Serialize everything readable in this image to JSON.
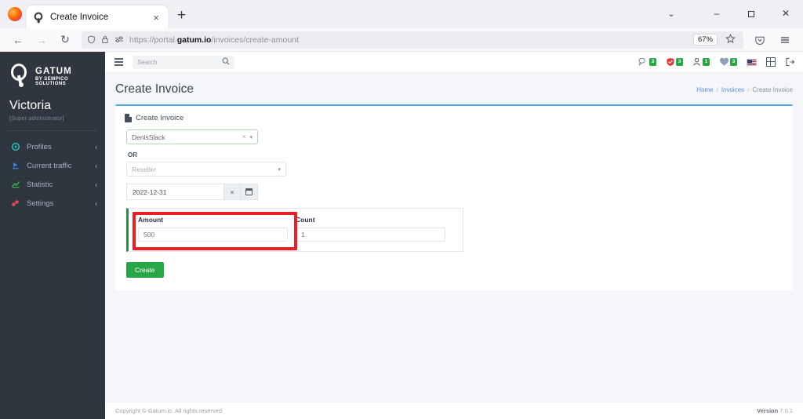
{
  "browser": {
    "tab": {
      "title": "Create Invoice",
      "favicon": "gatum-logo-icon",
      "close_label": "×"
    },
    "newtab_label": "+",
    "window_controls": {
      "chevron": "⌄",
      "minimize": "–",
      "maximize": "❐",
      "close": "✕"
    },
    "nav": {
      "back": "←",
      "forward": "→",
      "reload": "↻"
    },
    "url": {
      "prefix": "https://portal.",
      "domain": "gatum.io",
      "path": "/invoices/create-amount"
    },
    "zoom_level": "67%",
    "icons": {
      "shield": "shield-icon",
      "lock": "lock-icon",
      "tracking": "tracking-protection-icon",
      "bookmark": "star-icon",
      "pocket": "pocket-icon",
      "menu": "app-menu-icon"
    }
  },
  "sidebar": {
    "brand": {
      "name": "GATUM",
      "subtitle": "BY SEMPICO SOLUTIONS"
    },
    "user": {
      "name": "Victoria",
      "role": "[Super administrator]"
    },
    "items": [
      {
        "label": "Profiles",
        "icon": "profiles-icon",
        "color": "#2bb5a8",
        "chevron": "‹"
      },
      {
        "label": "Current traffic",
        "icon": "traffic-icon",
        "color": "#3b7ddd",
        "chevron": "‹"
      },
      {
        "label": "Statistic",
        "icon": "statistic-icon",
        "color": "#3fae4a",
        "chevron": "‹"
      },
      {
        "label": "Settings",
        "icon": "settings-icon",
        "color": "#e04b4b",
        "chevron": "‹"
      }
    ]
  },
  "topbar": {
    "menu_toggle": "hamburger-icon",
    "search": {
      "placeholder": "Search",
      "value": ""
    },
    "search_icon": "search-icon",
    "icons": [
      {
        "name": "support-ticket-icon",
        "glyph": "☎",
        "badge": "3"
      },
      {
        "name": "alerts-icon",
        "glyph": "⛑",
        "badge": "3"
      },
      {
        "name": "users-online-icon",
        "glyph": "☺",
        "badge": "1"
      },
      {
        "name": "notifications-icon",
        "glyph": "♥",
        "badge": "3"
      }
    ],
    "language_flag": "us-flag-icon",
    "apps_grid": "grid-icon",
    "logout": "logout-icon"
  },
  "page": {
    "title": "Create Invoice",
    "breadcrumb": [
      {
        "label": "Home",
        "link": true
      },
      {
        "label": "Invoices",
        "link": true
      },
      {
        "label": "Create Invoice",
        "link": false
      }
    ],
    "breadcrumb_separator": "/"
  },
  "card": {
    "header": {
      "icon": "invoice-file-icon",
      "title": "Create Invoice"
    },
    "profile_select": {
      "value": "DenisSlack",
      "clear": "×",
      "caret": "▾"
    },
    "or_label": "OR",
    "reseller_select": {
      "placeholder": "Reseller",
      "value": "",
      "caret": "▾"
    },
    "date_field": {
      "value": "2022-12-31",
      "clear": "×",
      "calendar_icon": "calendar-icon"
    },
    "amount": {
      "label": "Amount",
      "value": "500"
    },
    "count": {
      "label": "Count",
      "value": "1"
    },
    "submit_label": "Create",
    "highlight": {
      "color": "#ee1c25",
      "target": "amount-field"
    },
    "accent_color": "#2e8b45"
  },
  "footer": {
    "copyright": "Copyright © Gatum.io. All rights reserved",
    "version_label": "Version",
    "version_number": "7.0.1"
  }
}
